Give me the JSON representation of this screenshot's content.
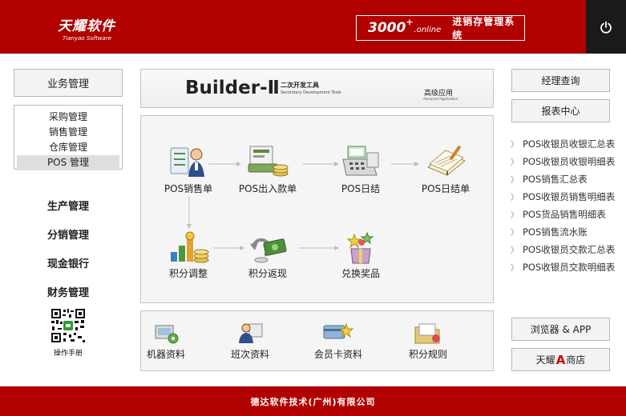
{
  "header": {
    "logo_cn": "天耀软件",
    "logo_en": "Tianyao Software",
    "product_num": "3000",
    "product_plus": "+",
    "product_suffix": ".online",
    "product_name": "进销存管理系统",
    "power_icon": "power-icon"
  },
  "sidebar": {
    "header": "业务管理",
    "submenu": [
      "采购管理",
      "销售管理",
      "仓库管理",
      "POS 管理"
    ],
    "active_index": 3,
    "menu": [
      "生产管理",
      "分销管理",
      "现金银行",
      "财务管理"
    ],
    "qr_label": "操作手册"
  },
  "banner": {
    "title": "Builder-Ⅱ",
    "sub_cn": "二次开发工具",
    "sub_en": "Secondary Development Tools",
    "adv_cn": "高级应用",
    "adv_en": "Advanced Application"
  },
  "flow": {
    "nodes": [
      {
        "label": "POS销售单",
        "icon": "cashier-person-icon"
      },
      {
        "label": "POS出入款单",
        "icon": "money-stack-icon"
      },
      {
        "label": "POS日结",
        "icon": "pos-machine-icon"
      },
      {
        "label": "POS日结单",
        "icon": "notebook-icon"
      },
      {
        "label": "积分调整",
        "icon": "coins-chart-icon"
      },
      {
        "label": "积分返现",
        "icon": "cash-back-icon"
      },
      {
        "label": "兑换奖品",
        "icon": "gift-box-icon"
      }
    ]
  },
  "tools": [
    {
      "label": "机器资料",
      "icon": "machine-gear-icon"
    },
    {
      "label": "班次资料",
      "icon": "staff-shift-icon"
    },
    {
      "label": "会员卡资料",
      "icon": "member-card-icon"
    },
    {
      "label": "积分规则",
      "icon": "folder-rules-icon"
    }
  ],
  "right": {
    "manager_query": "经理查询",
    "report_center": "报表中心",
    "reports": [
      "POS收银员收银汇总表",
      "POS收银员收银明细表",
      "POS销售汇总表",
      "POS收银员销售明细表",
      "POS货品销售明细表",
      "POS销售流水账",
      "POS收银员交款汇总表",
      "POS收银员交款明细表"
    ],
    "browser_app": "浏览器 & APP",
    "mall_pre": "天耀",
    "mall_letter": "A",
    "mall_post": "商店"
  },
  "footer": {
    "company": "德达软件技术(广州)有限公司"
  },
  "colors": {
    "brand_red": "#b10000",
    "power_bg": "#1a1a1a",
    "mall_accent": "#d20000"
  }
}
